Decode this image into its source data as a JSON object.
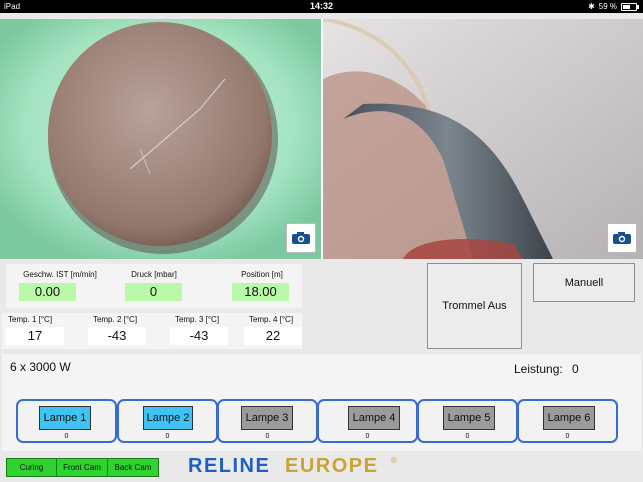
{
  "statusbar": {
    "device": "iPad",
    "time": "14:32",
    "battery": "59 %"
  },
  "measurements": [
    {
      "label": "Geschw. IST [m/min]",
      "value": "0.00"
    },
    {
      "label": "Druck [mbar]",
      "value": "0"
    },
    {
      "label": "Position [m]",
      "value": "18.00"
    }
  ],
  "temperatures": [
    {
      "label": "Temp. 1 [°C]",
      "value": "17"
    },
    {
      "label": "Temp. 2 [°C]",
      "value": "-43"
    },
    {
      "label": "Temp. 3 [°C]",
      "value": "-43"
    },
    {
      "label": "Temp. 4 [°C]",
      "value": "22"
    }
  ],
  "controls": {
    "trommel_label": "Trommel Aus",
    "manuell_label": "Manuell"
  },
  "lamps_panel": {
    "config": "6 x 3000 W",
    "leistung_label": "Leistung:",
    "leistung_value": "0",
    "lamps": [
      {
        "label": "Lampe 1",
        "value": "0",
        "active": true
      },
      {
        "label": "Lampe 2",
        "value": "0",
        "active": true
      },
      {
        "label": "Lampe 3",
        "value": "0",
        "active": false
      },
      {
        "label": "Lampe 4",
        "value": "0",
        "active": false
      },
      {
        "label": "Lampe 5",
        "value": "0",
        "active": false
      },
      {
        "label": "Lampe 6",
        "value": "0",
        "active": false
      }
    ]
  },
  "tabs": [
    {
      "label": "Curing"
    },
    {
      "label": "Front Cam"
    },
    {
      "label": "Back Cam"
    }
  ],
  "logo": {
    "text": "RELINEEUROPE",
    "mark": "®"
  },
  "colors": {
    "lamp_active": "#3fc3f5",
    "lamp_inactive": "#9b9b9b",
    "value_green": "#b9f7a9",
    "tab_green": "#2fd32f",
    "logo_blue": "#1f5fbf",
    "logo_gold": "#c8a533"
  },
  "icons": {
    "camera_button": "camera-icon"
  }
}
